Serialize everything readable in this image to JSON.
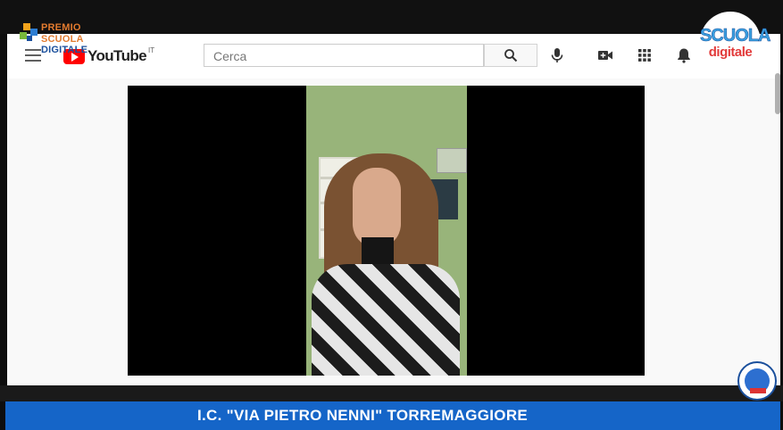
{
  "overlay": {
    "premio_logo": {
      "line1": "PREMIO",
      "line2_a": "SCUOLA",
      "line2_b": "DIGITALE"
    },
    "scuola_digitale_logo": {
      "line1": "SCUOLA",
      "line2": "digitale"
    },
    "ticker": {
      "text": "I.C. \"VIA PIETRO NENNI\" TORREMAGGIORE"
    }
  },
  "youtube": {
    "logo_text": "YouTube",
    "country_code": "IT",
    "search": {
      "placeholder": "Cerca"
    },
    "icons": [
      "menu-icon",
      "search-icon",
      "microphone-icon",
      "create-video-icon",
      "apps-grid-icon",
      "notifications-bell-icon"
    ]
  },
  "colors": {
    "ticker_bg": "#1565c8",
    "youtube_red": "#ff0000",
    "premio_orange": "#e27b2f",
    "scuola_blue": "#1a4f9c"
  }
}
